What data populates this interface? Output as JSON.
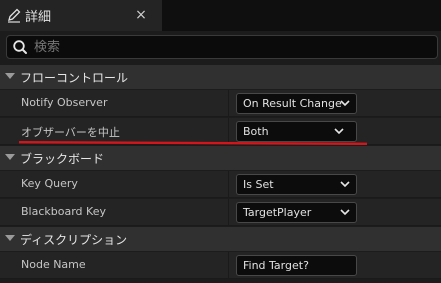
{
  "tab": {
    "title": "詳細",
    "icon": "pencil-icon",
    "close_glyph": "×"
  },
  "search": {
    "placeholder": "検索",
    "value": "",
    "icon": "search-icon"
  },
  "categories": [
    {
      "label": "フローコントロール",
      "rows": [
        {
          "label": "Notify Observer",
          "value": "On Result Change",
          "control": "dropdown"
        },
        {
          "label": "オブザーバーを中止",
          "value": "Both",
          "control": "dropdown"
        }
      ]
    },
    {
      "label": "ブラックボード",
      "rows": [
        {
          "label": "Key Query",
          "value": "Is Set",
          "control": "dropdown"
        },
        {
          "label": "Blackboard Key",
          "value": "TargetPlayer",
          "control": "dropdown"
        }
      ]
    },
    {
      "label": "ディスクリプション",
      "rows": [
        {
          "label": "Node Name",
          "value": "Find Target?",
          "control": "text"
        }
      ]
    }
  ],
  "colors": {
    "panel_bg": "#1c1c1c",
    "row_bg": "#242424",
    "category_bg": "#303030",
    "field_bg": "#0c0c0c",
    "annotation_red": "#d4161c"
  }
}
